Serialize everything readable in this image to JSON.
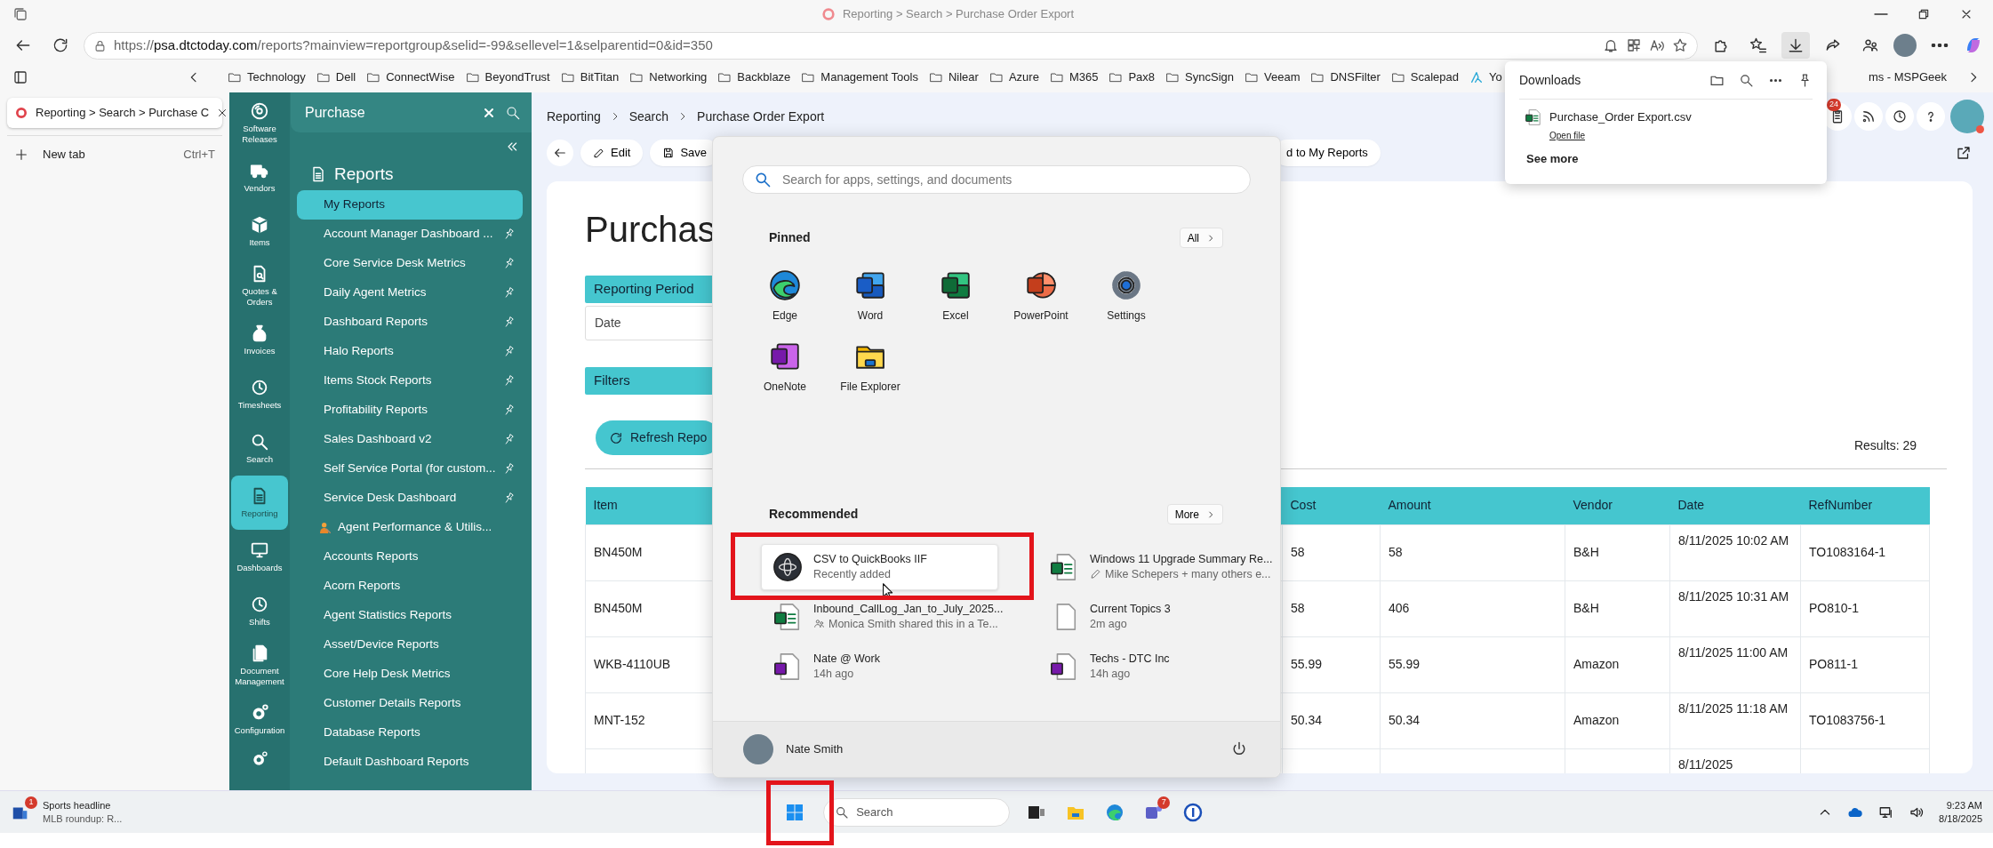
{
  "browser": {
    "window_title": "Reporting > Search > Purchase Order Export",
    "url": {
      "scheme": "https://",
      "domain": "psa.dtctoday.com",
      "path": "/reports?mainview=reportgroup&selid=-99&sellevel=1&selparentid=0&id=350"
    },
    "bookmarks": [
      {
        "label": "Technology",
        "kind": "folder"
      },
      {
        "label": "Dell",
        "kind": "folder"
      },
      {
        "label": "ConnectWise",
        "kind": "folder"
      },
      {
        "label": "BeyondTrust",
        "kind": "folder"
      },
      {
        "label": "BitTitan",
        "kind": "folder"
      },
      {
        "label": "Networking",
        "kind": "folder"
      },
      {
        "label": "Backblaze",
        "kind": "folder"
      },
      {
        "label": "Management Tools",
        "kind": "folder"
      },
      {
        "label": "Nilear",
        "kind": "folder"
      },
      {
        "label": "Azure",
        "kind": "folder"
      },
      {
        "label": "M365",
        "kind": "folder"
      },
      {
        "label": "Pax8",
        "kind": "folder"
      },
      {
        "label": "SyncSign",
        "kind": "folder"
      },
      {
        "label": "Veeam",
        "kind": "folder"
      },
      {
        "label": "DNSFilter",
        "kind": "folder"
      },
      {
        "label": "Scalepad",
        "kind": "folder"
      },
      {
        "label": "Yo",
        "kind": "site"
      },
      {
        "label": "ms - MSPGeek",
        "kind": "text"
      }
    ]
  },
  "vertical_tabs": {
    "tabs": [
      {
        "title": "Reporting > Search > Purchase C",
        "selected": true
      }
    ],
    "new_tab": "New tab",
    "shortcut": "Ctrl+T"
  },
  "rail": [
    {
      "label": "Software Releases",
      "kind": "releases",
      "selected": false
    },
    {
      "label": "Vendors",
      "kind": "vendors",
      "selected": false
    },
    {
      "label": "Items",
      "kind": "items",
      "selected": false
    },
    {
      "label": "Quotes & Orders",
      "kind": "quotes",
      "selected": false
    },
    {
      "label": "Invoices",
      "kind": "invoices",
      "selected": false
    },
    {
      "label": "Timesheets",
      "kind": "timesheets",
      "selected": false
    },
    {
      "label": "Search",
      "kind": "search",
      "selected": false
    },
    {
      "label": "Reporting",
      "kind": "reporting",
      "selected": true
    },
    {
      "label": "Dashboards",
      "kind": "dashboards",
      "selected": false
    },
    {
      "label": "Shifts",
      "kind": "shifts",
      "selected": false
    },
    {
      "label": "Document Management",
      "kind": "documents",
      "selected": false
    },
    {
      "label": "Configuration",
      "kind": "configuration",
      "selected": false
    }
  ],
  "nav": {
    "search_value": "Purchase",
    "heading": "Reports",
    "items": [
      {
        "label": "My Reports",
        "selected": true,
        "pin": false,
        "kind": "plain"
      },
      {
        "label": "Account Manager Dashboard ...",
        "selected": false,
        "pin": true,
        "kind": "plain"
      },
      {
        "label": "Core Service Desk Metrics",
        "selected": false,
        "pin": true,
        "kind": "plain"
      },
      {
        "label": "Daily Agent Metrics",
        "selected": false,
        "pin": true,
        "kind": "plain"
      },
      {
        "label": "Dashboard Reports",
        "selected": false,
        "pin": true,
        "kind": "plain"
      },
      {
        "label": "Halo Reports",
        "selected": false,
        "pin": true,
        "kind": "plain"
      },
      {
        "label": "Items Stock Reports",
        "selected": false,
        "pin": true,
        "kind": "plain"
      },
      {
        "label": "Profitability Reports",
        "selected": false,
        "pin": true,
        "kind": "plain"
      },
      {
        "label": "Sales Dashboard v2",
        "selected": false,
        "pin": true,
        "kind": "plain"
      },
      {
        "label": "Self Service Portal (for custom...",
        "selected": false,
        "pin": true,
        "kind": "plain"
      },
      {
        "label": "Service Desk Dashboard",
        "selected": false,
        "pin": true,
        "kind": "plain"
      },
      {
        "label": "Agent Performance & Utilis...",
        "selected": false,
        "pin": false,
        "kind": "emoji"
      },
      {
        "label": "Accounts Reports",
        "selected": false,
        "pin": false,
        "kind": "plain"
      },
      {
        "label": "Acorn Reports",
        "selected": false,
        "pin": false,
        "kind": "plain"
      },
      {
        "label": "Agent Statistics Reports",
        "selected": false,
        "pin": false,
        "kind": "plain"
      },
      {
        "label": "Asset/Device Reports",
        "selected": false,
        "pin": false,
        "kind": "plain"
      },
      {
        "label": "Core Help Desk Metrics",
        "selected": false,
        "pin": false,
        "kind": "plain"
      },
      {
        "label": "Customer Details Reports",
        "selected": false,
        "pin": false,
        "kind": "plain"
      },
      {
        "label": "Database Reports",
        "selected": false,
        "pin": false,
        "kind": "plain"
      },
      {
        "label": "Default Dashboard Reports",
        "selected": false,
        "pin": false,
        "kind": "plain"
      }
    ]
  },
  "page": {
    "breadcrumb": [
      "Reporting",
      "Search",
      "Purchase Order Export"
    ],
    "toolbar": [
      {
        "label": "Edit",
        "kind": "edit"
      },
      {
        "label": "Save",
        "kind": "save"
      },
      {
        "label": "d to My Reports",
        "kind": "plain"
      }
    ],
    "notification_count": "24"
  },
  "report": {
    "title": "Purchas",
    "period_heading": "Reporting Period",
    "date_field": "Date",
    "filters_heading": "Filters",
    "refresh_button": "Refresh Repo",
    "results": "Results: 29",
    "table": {
      "columns": [
        "Item",
        "Cost",
        "Amount",
        "Vendor",
        "Date",
        "RefNumber"
      ],
      "rows": [
        {
          "item": "BN450M",
          "cost": "58",
          "amount": "58",
          "vendor": "B&H",
          "date": "8/11/2025 10:02 AM",
          "ref": "TO1083164-1"
        },
        {
          "item": "BN450M",
          "cost": "58",
          "amount": "406",
          "vendor": "B&H",
          "date": "8/11/2025 10:31 AM",
          "ref": "PO810-1"
        },
        {
          "item": "WKB-4110UB",
          "cost": "55.99",
          "amount": "55.99",
          "vendor": "Amazon",
          "date": "8/11/2025 11:00 AM",
          "ref": "PO811-1"
        },
        {
          "item": "MNT-152",
          "cost": "50.34",
          "amount": "50.34",
          "vendor": "Amazon",
          "date": "8/11/2025 11:18 AM",
          "ref": "TO1083756-1"
        },
        {
          "date": "8/11/2025"
        }
      ]
    }
  },
  "start_menu": {
    "search_placeholder": "Search for apps, settings, and documents",
    "pinned_label": "Pinned",
    "all_button": "All",
    "pinned": [
      {
        "label": "Edge",
        "kind": "edge"
      },
      {
        "label": "Word",
        "kind": "word"
      },
      {
        "label": "Excel",
        "kind": "excel"
      },
      {
        "label": "PowerPoint",
        "kind": "powerpoint"
      },
      {
        "label": "Settings",
        "kind": "settings"
      },
      {
        "label": "OneNote",
        "kind": "onenote"
      },
      {
        "label": "File Explorer",
        "kind": "explorer"
      }
    ],
    "recommended_label": "Recommended",
    "more_button": "More",
    "recommended": [
      {
        "title": "CSV to QuickBooks IIF",
        "subtitle": {
          "text": "Recently added"
        },
        "kind": "app",
        "hovered": true
      },
      {
        "title": "Windows 11 Upgrade Summary Re...",
        "subtitle": {
          "text": "Mike Schepers + many others e...",
          "kind": "edited"
        },
        "kind": "excel",
        "hovered": false
      },
      {
        "title": "Inbound_CallLog_Jan_to_July_2025...",
        "subtitle": {
          "text": "Monica Smith shared this in a Te...",
          "kind": "shared"
        },
        "kind": "excel",
        "hovered": false
      },
      {
        "title": "Current Topics 3",
        "subtitle": {
          "text": "2m ago"
        },
        "kind": "file",
        "hovered": false
      },
      {
        "title": "Nate @ Work",
        "subtitle": {
          "text": "14h ago"
        },
        "kind": "onenote",
        "hovered": false
      },
      {
        "title": "Techs - DTC Inc",
        "subtitle": {
          "text": "14h ago"
        },
        "kind": "onenote",
        "hovered": false
      }
    ],
    "user": "Nate Smith"
  },
  "downloads": {
    "title": "Downloads",
    "file": "Purchase_Order Export.csv",
    "open_link": "Open file",
    "see_more": "See more"
  },
  "taskbar": {
    "widget_title": "Sports headline",
    "widget_subtitle": "MLB roundup: R...",
    "widget_badge": "1",
    "search_placeholder": "Search",
    "teams_badge": "7",
    "time": "9:23 AM",
    "date": "8/18/2025"
  }
}
